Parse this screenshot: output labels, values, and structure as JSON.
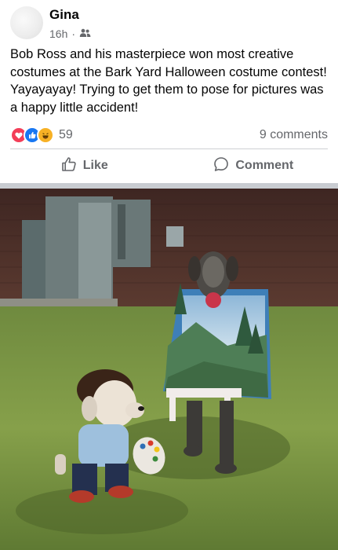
{
  "post": {
    "author": "Gina",
    "time": "16h",
    "audience_icon": "friends-icon",
    "text": "Bob Ross and his masterpiece won most creative costumes at the Bark Yard Halloween costume contest! Yayayayay! Trying to get them to pose for pictures was a happy little accident!",
    "reactions": {
      "types": [
        "love",
        "like",
        "haha"
      ],
      "count": "59"
    },
    "comments": "9 comments",
    "actions": {
      "like": "Like",
      "comment": "Comment"
    },
    "photo": {
      "subject": "photo"
    }
  },
  "colors": {
    "secondary_text": "#65676b",
    "like_blue": "#1877f2",
    "love_red": "#f33e58",
    "haha_yellow": "#f7b125",
    "divider": "#ced0d4"
  }
}
